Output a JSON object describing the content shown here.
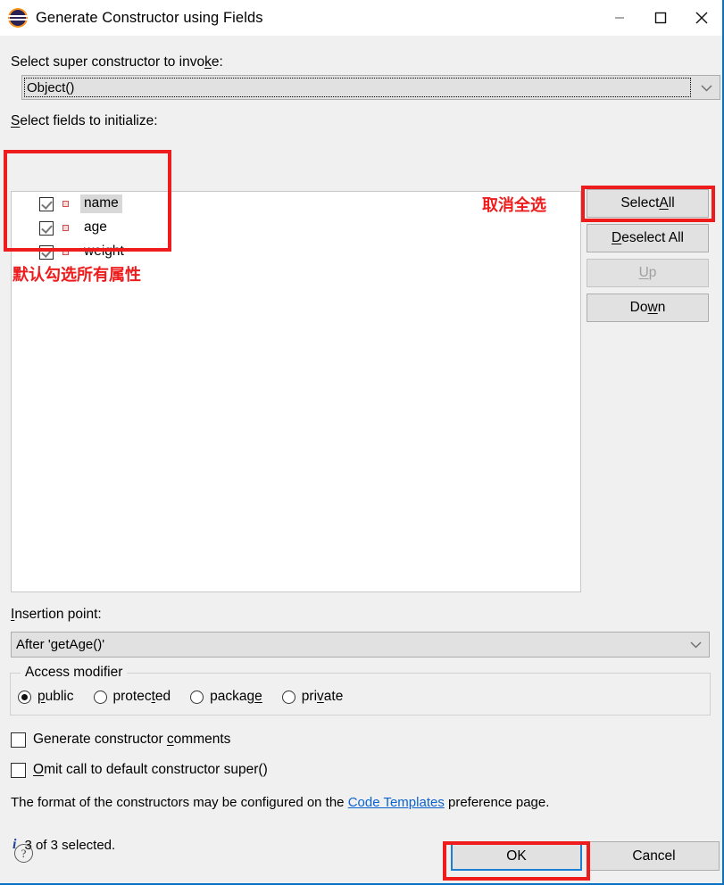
{
  "window": {
    "title": "Generate Constructor using Fields",
    "icon": "eclipse-icon",
    "controls": {
      "minimize": "minimize-icon",
      "maximize": "maximize-icon",
      "close": "close-icon"
    }
  },
  "super_constructor": {
    "label_before": "Select super constructor to invo",
    "label_mnemonic": "k",
    "label_after": "e:",
    "value": "Object()",
    "arrow": "chevron-down-icon"
  },
  "fields": {
    "label_mnemonic": "S",
    "label_after": "elect fields to initialize:",
    "items": [
      {
        "name": "name",
        "checked": true,
        "selected": true
      },
      {
        "name": "age",
        "checked": true,
        "selected": false
      },
      {
        "name": "weight",
        "checked": true,
        "selected": false
      }
    ]
  },
  "side_buttons": [
    {
      "before": "Select ",
      "mnemonic": "A",
      "after": "ll",
      "enabled": true
    },
    {
      "before": "",
      "mnemonic": "D",
      "after": "eselect All",
      "enabled": true
    },
    {
      "before": "",
      "mnemonic": "U",
      "after": "p",
      "enabled": false
    },
    {
      "before": "Do",
      "mnemonic": "w",
      "after": "n",
      "enabled": true
    }
  ],
  "insertion_point": {
    "label_mnemonic": "I",
    "label_after": "nsertion point:",
    "value": "After 'getAge()'",
    "arrow": "chevron-down-icon"
  },
  "access_modifier": {
    "group_title": "Access modifier",
    "options": [
      {
        "before": "",
        "mnemonic": "p",
        "after": "ublic",
        "selected": true
      },
      {
        "before": "protec",
        "mnemonic": "t",
        "after": "ed",
        "selected": false
      },
      {
        "before": "packag",
        "mnemonic": "e",
        "after": "",
        "selected": false
      },
      {
        "before": "pri",
        "mnemonic": "v",
        "after": "ate",
        "selected": false
      }
    ]
  },
  "options": [
    {
      "before": "Generate constructor ",
      "mnemonic": "c",
      "after": "omments",
      "checked": false
    },
    {
      "before": "",
      "mnemonic": "O",
      "after": "mit call to default constructor super()",
      "checked": false
    }
  ],
  "format_note": {
    "text_before": "The format of the constructors may be configured on the ",
    "link": "Code Templates",
    "text_after": " preference page."
  },
  "status": {
    "icon": "info-icon",
    "glyph": "i",
    "text": "3 of 3 selected."
  },
  "footer": {
    "help": "help-icon",
    "help_glyph": "?",
    "ok": "OK",
    "cancel": "Cancel"
  },
  "annotations": [
    {
      "text": "默认勾选所有属性",
      "color": "#ee1c1c"
    },
    {
      "text": "取消全选",
      "color": "#ee1c1c"
    }
  ]
}
